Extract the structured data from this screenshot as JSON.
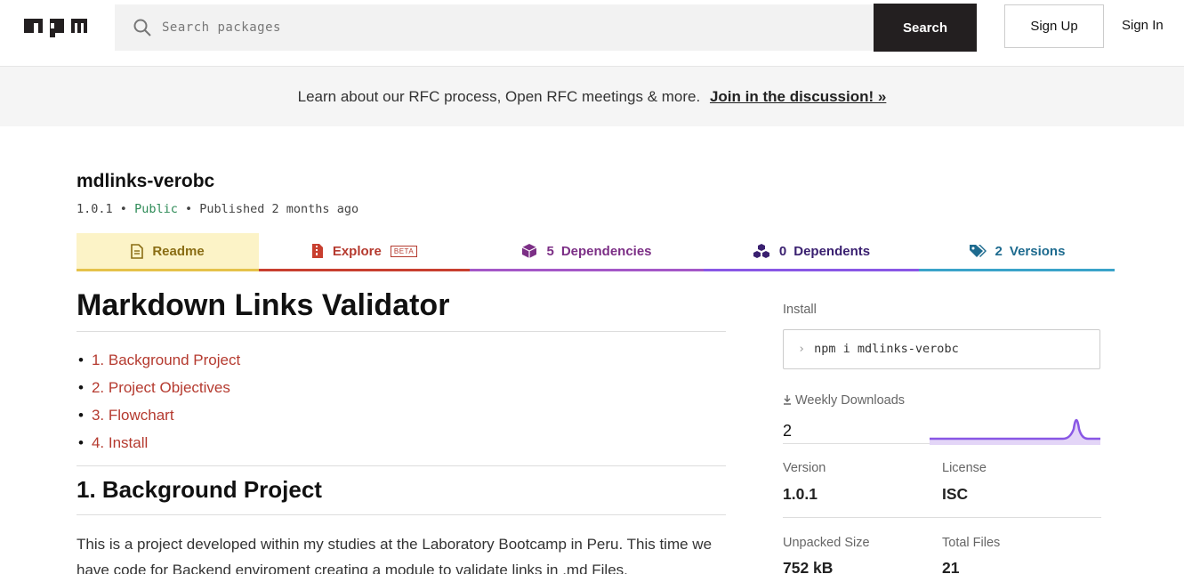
{
  "header": {
    "logo_text": "npm",
    "search_placeholder": "Search packages",
    "search_button": "Search",
    "signup": "Sign Up",
    "signin": "Sign In"
  },
  "banner": {
    "text": "Learn about our RFC process, Open RFC meetings & more.",
    "link": "Join in the discussion! »"
  },
  "package": {
    "name": "mdlinks-verobc",
    "version": "1.0.1",
    "sep": "•",
    "visibility": "Public",
    "published": "Published 2 months ago"
  },
  "tabs": {
    "readme": "Readme",
    "explore": "Explore",
    "explore_badge": "BETA",
    "dependencies_count": "5",
    "dependencies": "Dependencies",
    "dependents_count": "0",
    "dependents": "Dependents",
    "versions_count": "2",
    "versions": "Versions"
  },
  "readme": {
    "title": "Markdown Links Validator",
    "toc": [
      "1. Background Project",
      "2. Project Objectives",
      "3. Flowchart",
      "4. Install"
    ],
    "section_title": "1. Background Project",
    "paragraph": "This is a project developed within my studies at the Laboratory Bootcamp in Peru. This time we have code for Backend enviroment creating a module to validate links in .md Files."
  },
  "sidebar": {
    "install_label": "Install",
    "install_command": "npm i mdlinks-verobc",
    "weekly_downloads_label": "Weekly Downloads",
    "weekly_downloads": "2",
    "version_label": "Version",
    "version": "1.0.1",
    "license_label": "License",
    "license": "ISC",
    "unpacked_size_label": "Unpacked Size",
    "unpacked_size": "752 kB",
    "total_files_label": "Total Files",
    "total_files": "21"
  },
  "colors": {
    "accent_red": "#c83f2f",
    "readme_yellow": "#fcf3c7",
    "spark_purple": "#8957e5"
  }
}
